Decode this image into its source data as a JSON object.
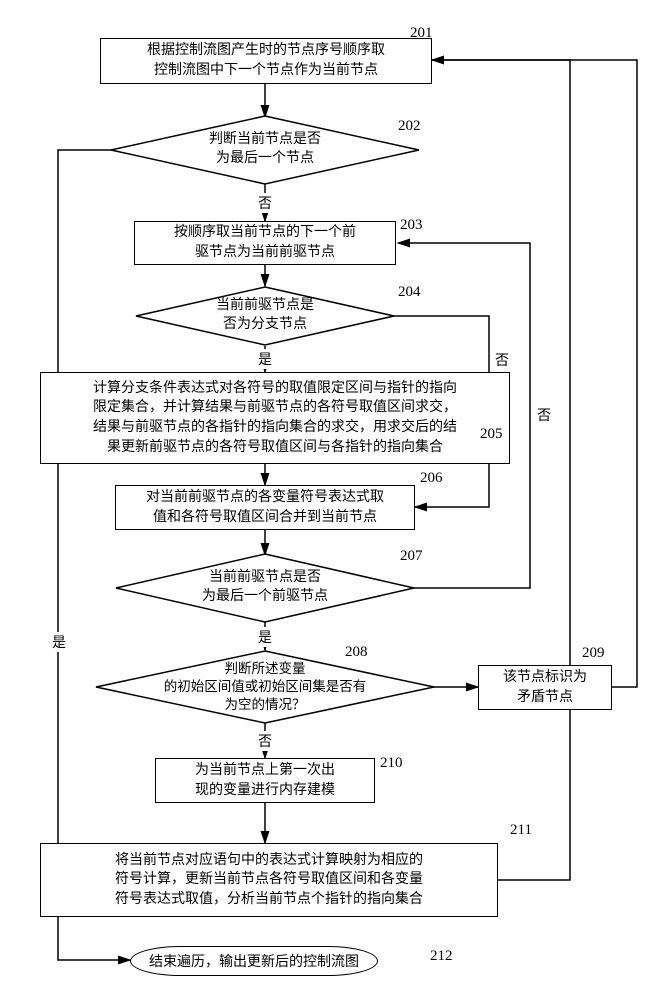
{
  "chart_data": {
    "type": "flowchart",
    "title": "",
    "nodes": [
      {
        "id": "201",
        "shape": "rect",
        "text": "根据控制流图产生时的节点序号顺序取\n控制流图中下一个节点作为当前节点"
      },
      {
        "id": "202",
        "shape": "diamond",
        "text": "判断当前节点是否\n为最后一个节点"
      },
      {
        "id": "203",
        "shape": "rect",
        "text": "按顺序取当前节点的下一个前\n驱节点为当前前驱节点"
      },
      {
        "id": "204",
        "shape": "diamond",
        "text": "当前前驱节点是\n否为分支节点"
      },
      {
        "id": "205",
        "shape": "rect",
        "text": "计算分支条件表达式对各符号的取值限定区间与指针的指向\n限定集合，并计算结果与前驱节点的各符号取值区间求交，\n结果与前驱节点的各指针的指向集合的求交，用求交后的结\n果更新前驱节点的各符号取值区间与各指针的指向集合"
      },
      {
        "id": "206",
        "shape": "rect",
        "text": "对当前前驱节点的各变量符号表达式取\n值和各符号取值区间合并到当前节点"
      },
      {
        "id": "207",
        "shape": "diamond",
        "text": "当前前驱节点是否\n为最后一个前驱节点"
      },
      {
        "id": "208",
        "shape": "diamond",
        "text": "判断所述变量\n的初始区间值或初始区间集是否有\n为空的情况？"
      },
      {
        "id": "209",
        "shape": "rect",
        "text": "该节点标识为\n矛盾节点"
      },
      {
        "id": "210",
        "shape": "rect",
        "text": "为当前节点上第一次出\n现的变量进行内存建模"
      },
      {
        "id": "211",
        "shape": "rect",
        "text": "将当前节点对应语句中的表达式计算映射为相应的\n符号计算，更新当前节点各符号取值区间和各变量\n符号表达式取值，分析当前节点个指针的指向集合"
      },
      {
        "id": "212",
        "shape": "oval",
        "text": "结束遍历，输出更新后的控制流图"
      }
    ],
    "edges": [
      {
        "from": "201",
        "to": "202",
        "label": ""
      },
      {
        "from": "202",
        "to": "203",
        "label": "否"
      },
      {
        "from": "202",
        "to": "212",
        "label": "是"
      },
      {
        "from": "203",
        "to": "204",
        "label": ""
      },
      {
        "from": "204",
        "to": "205",
        "label": "是"
      },
      {
        "from": "204",
        "to": "206",
        "label": "否"
      },
      {
        "from": "205",
        "to": "206",
        "label": ""
      },
      {
        "from": "206",
        "to": "207",
        "label": ""
      },
      {
        "from": "207",
        "to": "208",
        "label": "是"
      },
      {
        "from": "207",
        "to": "203",
        "label": "否"
      },
      {
        "from": "208",
        "to": "209",
        "label": ""
      },
      {
        "from": "208",
        "to": "210",
        "label": "否"
      },
      {
        "from": "209",
        "to": "201",
        "label": ""
      },
      {
        "from": "210",
        "to": "211",
        "label": ""
      },
      {
        "from": "211",
        "to": "201",
        "label": ""
      }
    ],
    "edge_labels": {
      "yes": "是",
      "no": "否"
    }
  },
  "labels": {
    "n201": "201",
    "n202": "202",
    "n203": "203",
    "n204": "204",
    "n205": "205",
    "n206": "206",
    "n207": "207",
    "n208": "208",
    "n209": "209",
    "n210": "210",
    "n211": "211",
    "n212": "212"
  }
}
